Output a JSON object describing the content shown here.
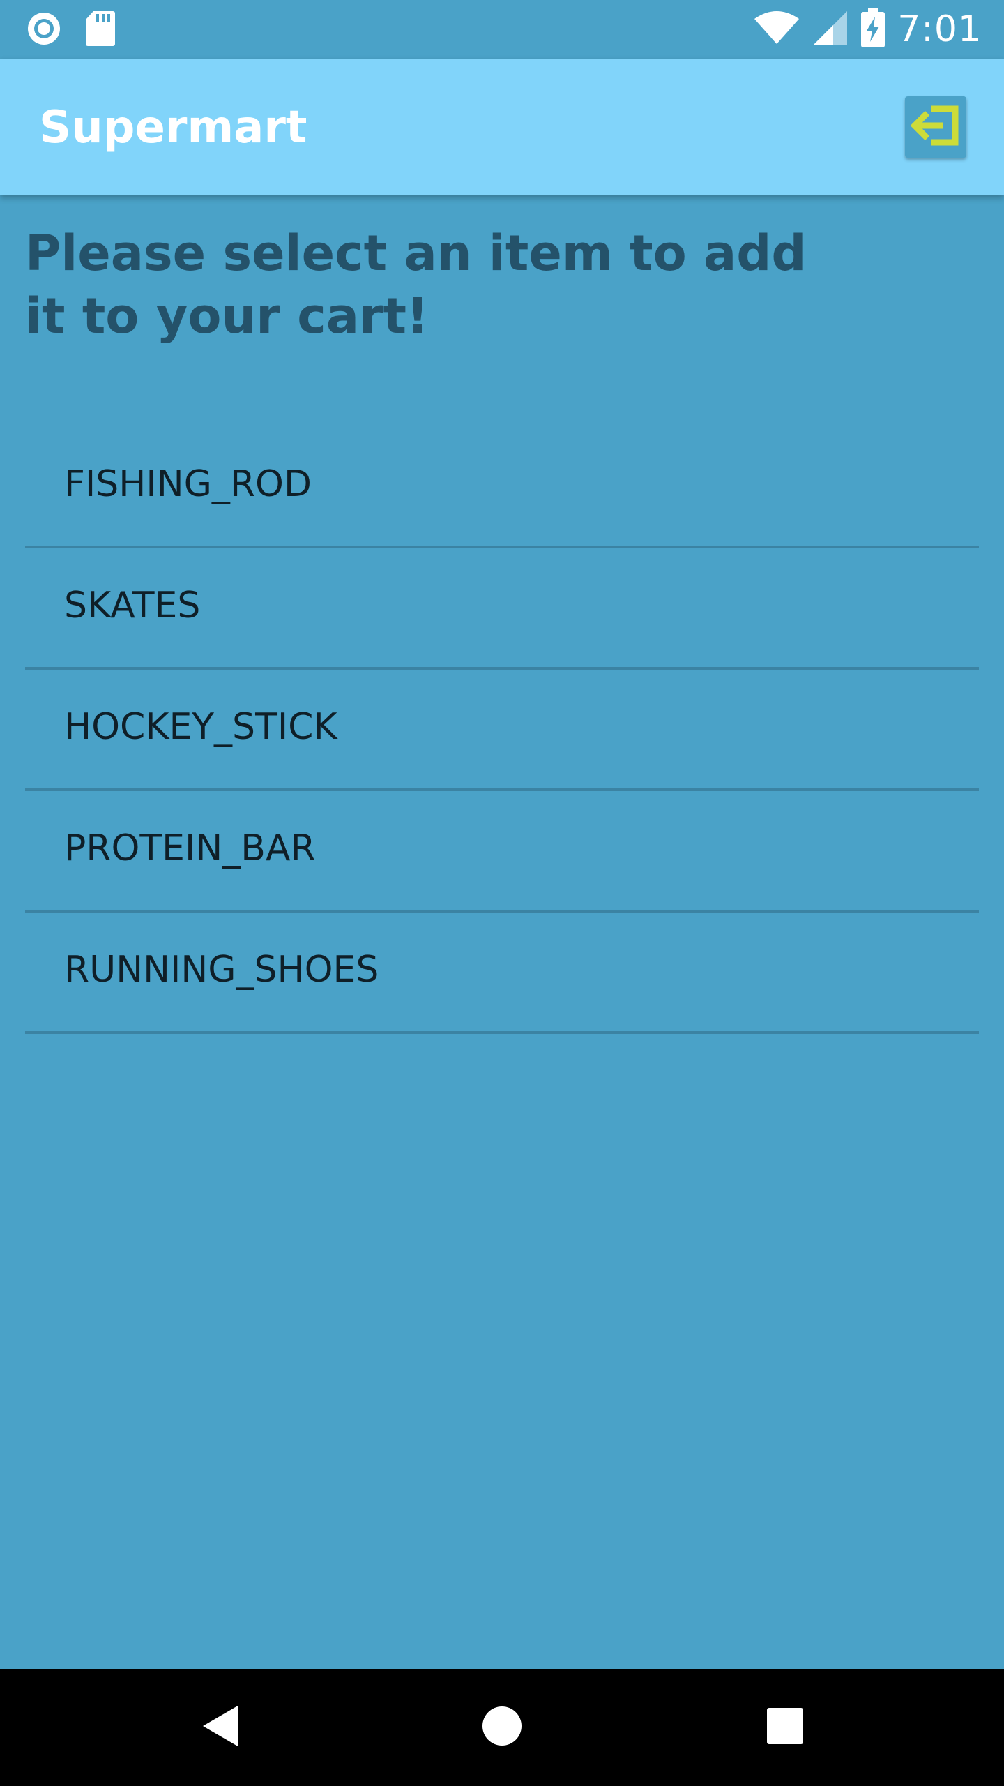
{
  "status_bar": {
    "time": "7:01",
    "left_icons": [
      "record-icon",
      "sd-card-icon"
    ],
    "right_icons": [
      "wifi-icon",
      "cell-signal-icon",
      "battery-charging-icon"
    ]
  },
  "app_bar": {
    "title": "Supermart",
    "logout_icon": "logout-arrow-icon",
    "accent_color": "#81d4fa",
    "icon_color": "#cddc39"
  },
  "main": {
    "heading": "Please select an item to add it to your cart!",
    "items": [
      {
        "label": "FISHING_ROD"
      },
      {
        "label": "SKATES"
      },
      {
        "label": "HOCKEY_STICK"
      },
      {
        "label": "PROTEIN_BAR"
      },
      {
        "label": "RUNNING_SHOES"
      }
    ]
  },
  "nav_bar": {
    "buttons": [
      "back-icon",
      "home-icon",
      "recents-icon"
    ]
  }
}
